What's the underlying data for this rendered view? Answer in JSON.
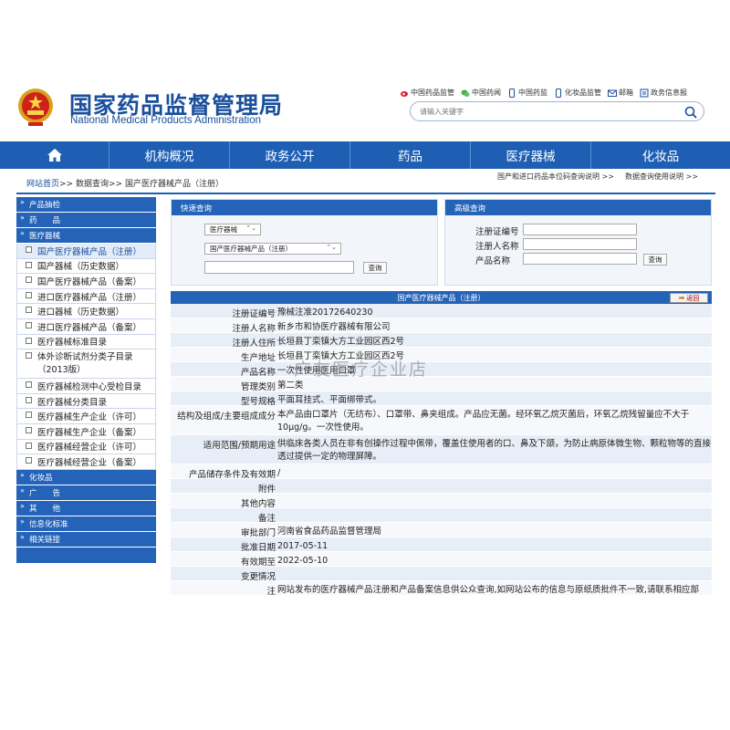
{
  "header": {
    "title_cn": "国家药品监督管理局",
    "title_en": "National Medical Products Administration",
    "top_links": [
      {
        "label": "中国药品监管",
        "icon": "weibo-icon"
      },
      {
        "label": "中国药闻",
        "icon": "wechat-icon"
      },
      {
        "label": "中国药监",
        "icon": "mobile-app-icon"
      },
      {
        "label": "化妆品监管",
        "icon": "mobile-app-icon"
      },
      {
        "label": "邮箱",
        "icon": "mail-icon"
      },
      {
        "label": "政务信息报",
        "icon": "report-icon"
      }
    ],
    "search_placeholder": "请输入关键字"
  },
  "nav": {
    "items": [
      "机构概况",
      "政务公开",
      "药品",
      "医疗器械",
      "化妆品"
    ]
  },
  "breadcrumb": {
    "home": "网站首页",
    "sep1": ">>",
    "query": "数据查询",
    "sep2": ">>",
    "current": "国产医疗器械产品（注册）"
  },
  "right_links": [
    "国产和进口药品本位码查询说明 >>",
    "数据查询使用说明 >>"
  ],
  "sidebar": {
    "cat_drug_check": "产品抽检",
    "cat_drug": "药　　品",
    "cat_device": "医疗器械",
    "items": [
      "国产医疗器械产品（注册）",
      "国产器械（历史数据）",
      "国产医疗器械产品（备案）",
      "进口医疗器械产品（注册）",
      "进口器械（历史数据）",
      "进口医疗器械产品（备案）",
      "医疗器械标准目录",
      "体外诊断试剂分类子目录（2013版）",
      "医疗器械检测中心受检目录",
      "医疗器械分类目录",
      "医疗器械生产企业（许可）",
      "医疗器械生产企业（备案）",
      "医疗器械经营企业（许可）",
      "医疗器械经营企业（备案）"
    ],
    "cats_bottom": [
      "化妆品",
      "广　　告",
      "其　　他",
      "信息化标准",
      "相关链接"
    ]
  },
  "quick_search": {
    "title": "快速查询",
    "select1": "医疗器械",
    "select2": "国产医疗器械产品（注册）",
    "input_value": "",
    "button": "查询"
  },
  "advanced_search": {
    "title": "高级查询",
    "fields": [
      "注册证编号",
      "注册人名称",
      "产品名称"
    ],
    "button": "查询"
  },
  "detail": {
    "title": "国产医疗器械产品（注册）",
    "back_label": "返回",
    "rows": [
      {
        "label": "注册证编号",
        "value": "豫械注准20172640230"
      },
      {
        "label": "注册人名称",
        "value": "新乡市和协医疗器械有限公司"
      },
      {
        "label": "注册人住所",
        "value": "长垣县丁栾镇大方工业园区西2号"
      },
      {
        "label": "生产地址",
        "value": "长垣县丁栾镇大方工业园区西2号"
      },
      {
        "label": "产品名称",
        "value": "一次性使用医用口罩"
      },
      {
        "label": "管理类别",
        "value": "第二类"
      },
      {
        "label": "型号规格",
        "value": "平面耳挂式、平面绑带式。"
      },
      {
        "label": "结构及组成/主要组成成分",
        "value": "本产品由口罩片（无纺布）、口罩带、鼻夹组成。产品应无菌。经环氧乙烷灭菌后，环氧乙烷残留量应不大于10μg/g。一次性使用。"
      },
      {
        "label": "适用范围/预期用途",
        "value": "供临床各类人员在非有创操作过程中佩带，覆盖住使用者的口、鼻及下颌，为防止病原体微生物、颗粒物等的直接透过提供一定的物理屏障。"
      },
      {
        "label": "产品储存条件及有效期",
        "value": "/"
      },
      {
        "label": "附件",
        "value": ""
      },
      {
        "label": "其他内容",
        "value": ""
      },
      {
        "label": "备注",
        "value": ""
      },
      {
        "label": "审批部门",
        "value": "河南省食品药品监督管理局"
      },
      {
        "label": "批准日期",
        "value": "2017-05-11"
      },
      {
        "label": "有效期至",
        "value": "2022-05-10"
      },
      {
        "label": "变更情况",
        "value": ""
      },
      {
        "label": "注",
        "value": "网站发布的医疗器械产品注册和产品备案信息供公众查询,如网站公布的信息与原纸质批件不一致,请联系相应部"
      }
    ]
  },
  "watermark": "广友医疗企业店",
  "colors": {
    "brand_blue": "#1e5fb4",
    "sidebar_blue": "#2563b8",
    "title_blue": "#1a4f9c"
  }
}
